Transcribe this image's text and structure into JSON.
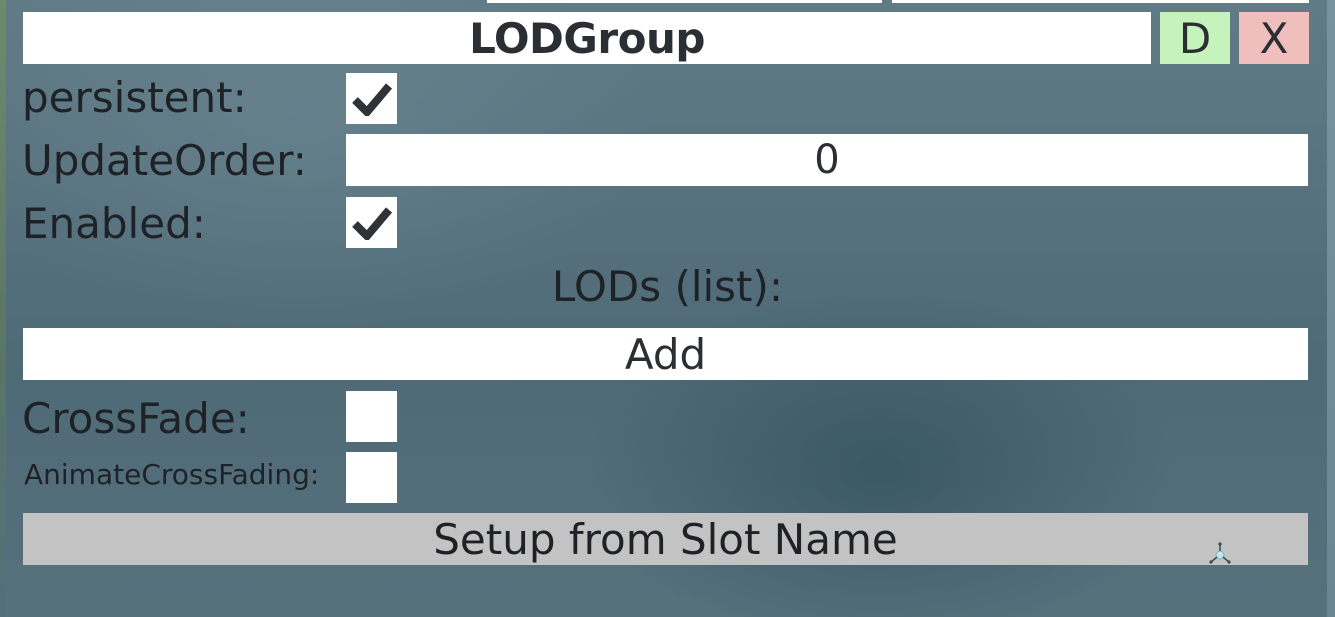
{
  "component": {
    "title": "LODGroup",
    "duplicate_label": "D",
    "remove_label": "X"
  },
  "fields": {
    "persistent": {
      "label": "persistent:",
      "checked": true
    },
    "update_order": {
      "label": "UpdateOrder:",
      "value": "0"
    },
    "enabled": {
      "label": "Enabled:",
      "checked": true
    },
    "lods": {
      "label": "LODs (list):",
      "add_label": "Add"
    },
    "cross_fade": {
      "label": "CrossFade:",
      "checked": false
    },
    "animate_cross_fading": {
      "label": "AnimateCrossFading:",
      "checked": false
    }
  },
  "actions": {
    "setup_label": "Setup from Slot Name"
  },
  "icons": {
    "check": "checkmark-icon",
    "cursor": "laser-cursor-icon"
  },
  "colors": {
    "duplicate_bg": "#c6f2bb",
    "remove_bg": "#f0bebd",
    "setup_bg": "#c3c3c3",
    "field_bg": "#ffffff"
  }
}
